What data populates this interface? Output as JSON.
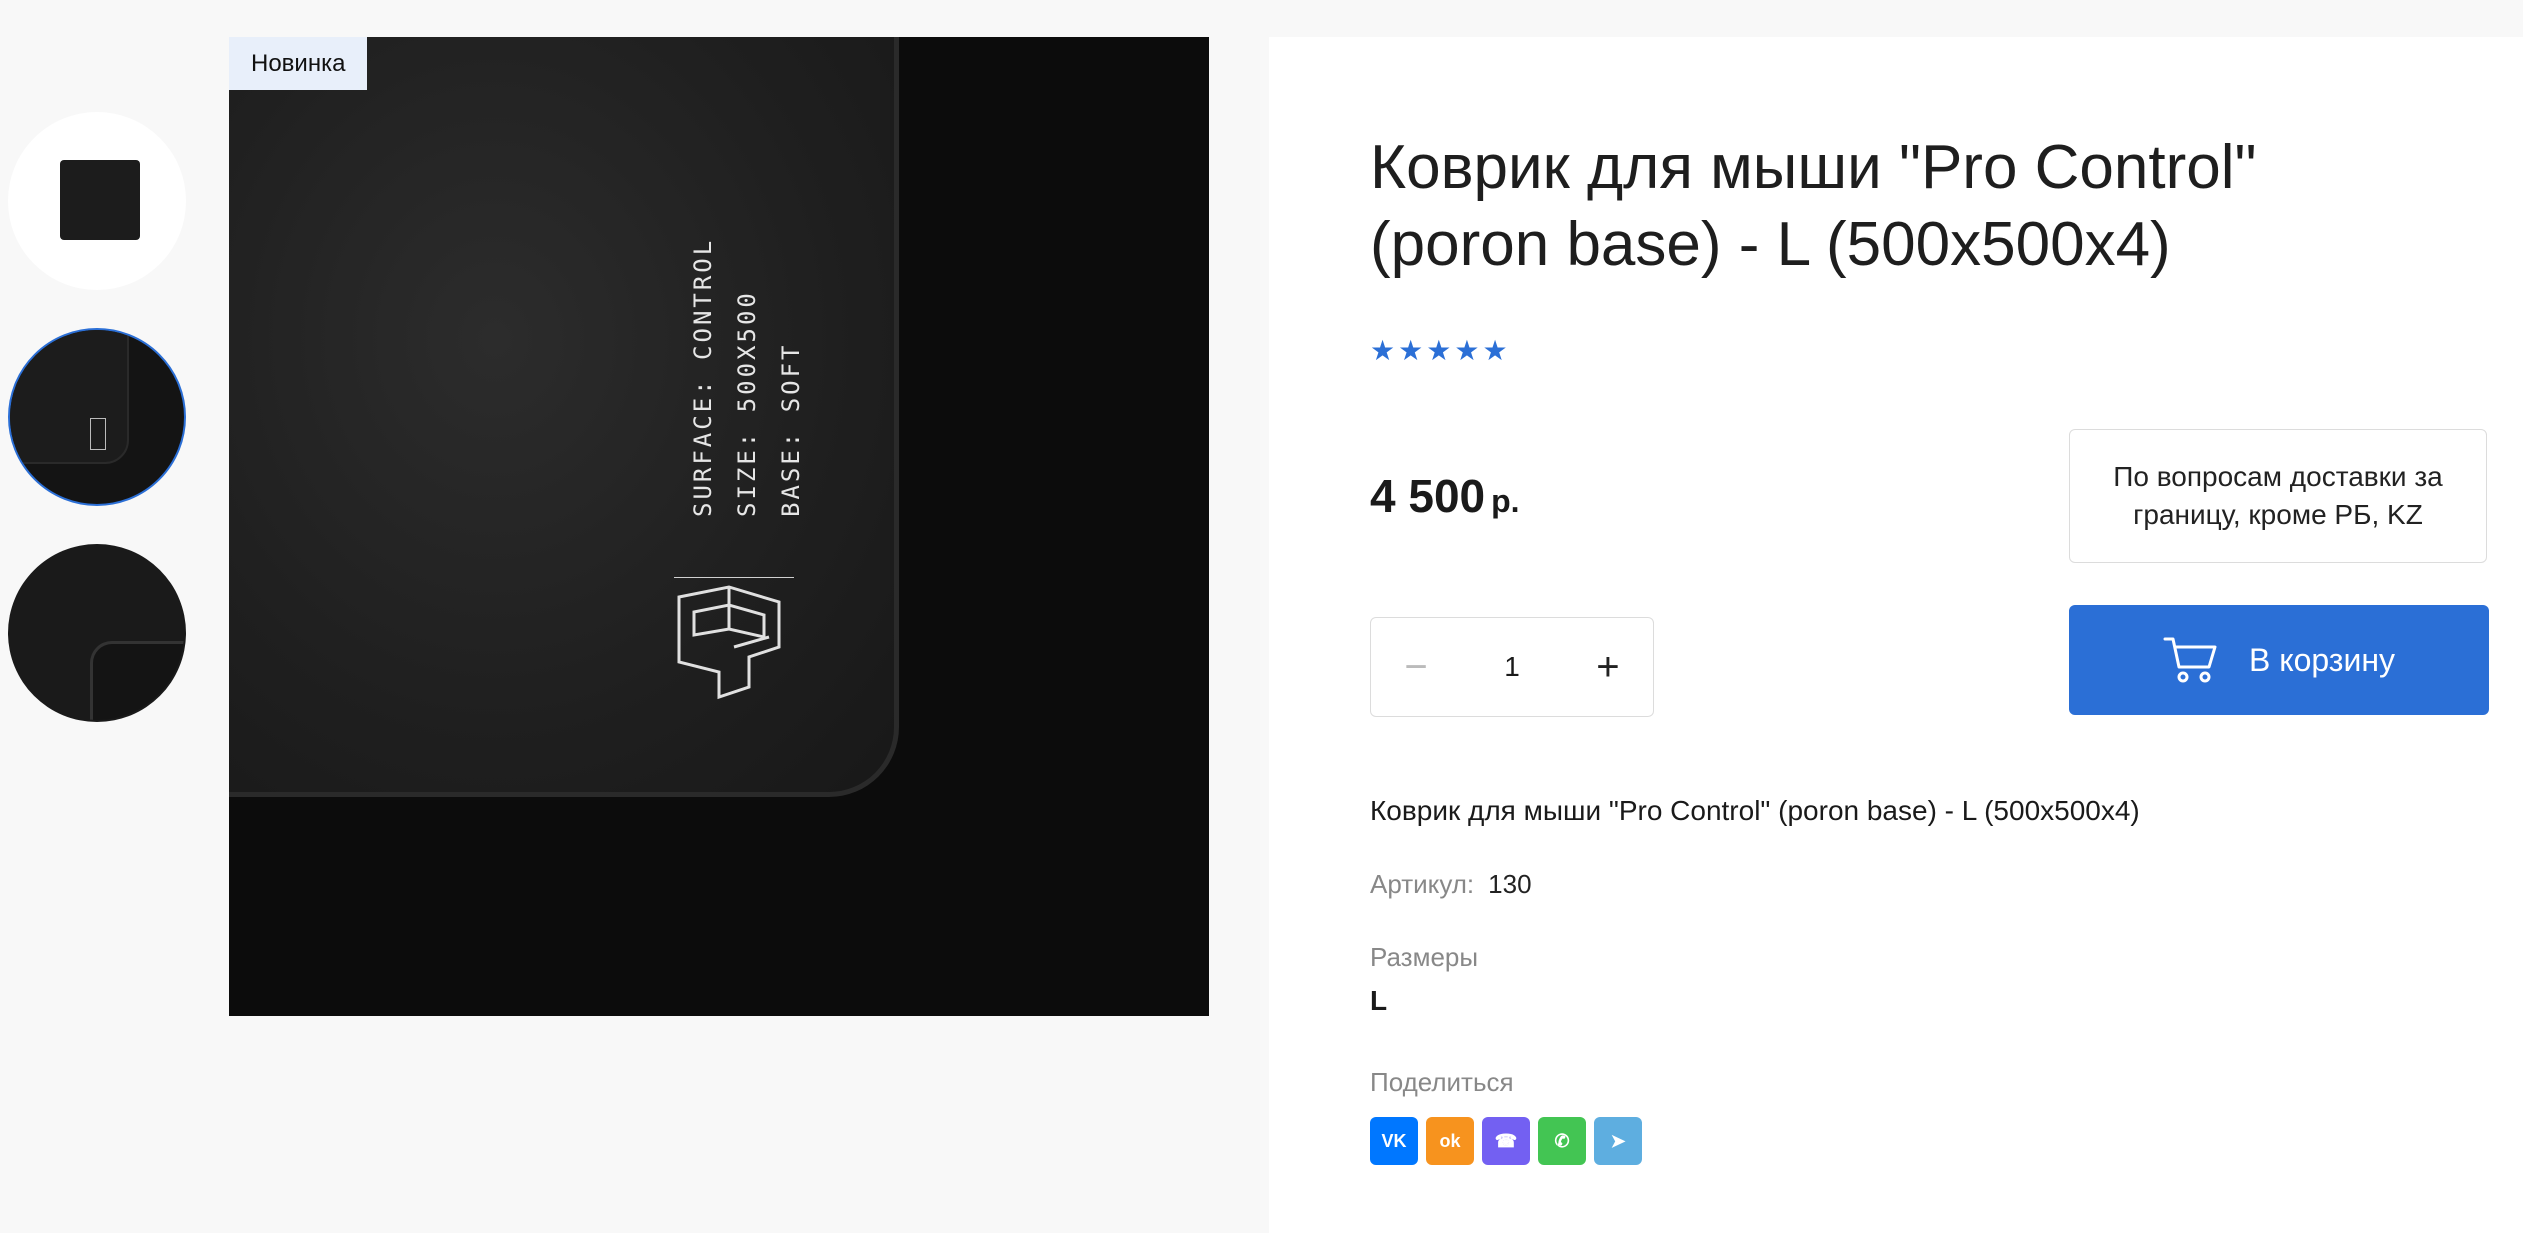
{
  "badge": "Новинка",
  "product": {
    "title": "Коврик для мыши \"Pro Control\" (poron base) - L (500x500x4)",
    "rating_stars": 5,
    "price_value": "4 500",
    "price_currency": "р.",
    "delivery_note": "По вопросам доставки за границу, кроме РБ, KZ",
    "quantity": "1",
    "cart_label": "В корзину",
    "description": "Коврик для мыши \"Pro Control\" (poron base) - L (500x500x4)",
    "sku_label": "Артикул:",
    "sku_value": "130",
    "sizes_label": "Размеры",
    "sizes_value": "L",
    "share_label": "Поделиться"
  },
  "photo_print": {
    "line1": "SURFACE: CONTROL",
    "line2": "SIZE: 500X500",
    "line3": "BASE: SOFT"
  },
  "share_buttons": [
    {
      "name": "vk",
      "color": "#0077ff",
      "glyph": "VK"
    },
    {
      "name": "odnoklassniki",
      "color": "#f7931e",
      "glyph": "ok"
    },
    {
      "name": "viber",
      "color": "#7360f2",
      "glyph": "☎"
    },
    {
      "name": "whatsapp",
      "color": "#43c553",
      "glyph": "✆"
    },
    {
      "name": "telegram",
      "color": "#5eaee0",
      "glyph": "➤"
    }
  ],
  "colors": {
    "accent": "#2b6fd6",
    "badge_bg": "#e8effa"
  }
}
